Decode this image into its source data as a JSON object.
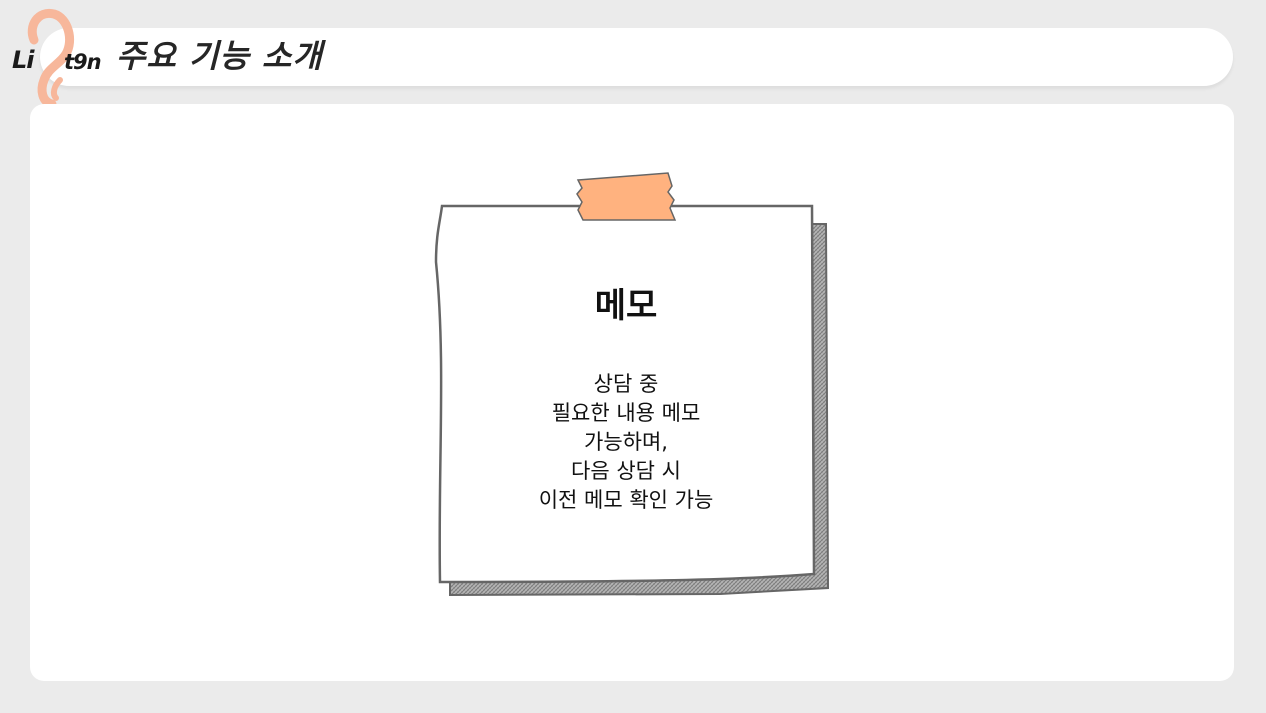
{
  "header": {
    "logo_text_left": "Li",
    "logo_text_right": "t9n",
    "title": "주요 기능 소개"
  },
  "note": {
    "title": "메모",
    "lines": [
      "상담 중",
      "필요한 내용 메모",
      "가능하며,",
      "다음 상담 시",
      "이전 메모 확인 가능"
    ]
  },
  "colors": {
    "background": "#ebebeb",
    "panel": "#ffffff",
    "tape": "#ffb27f",
    "logo_ear": "#f7b79b",
    "note_outline": "#666666"
  },
  "icons": {
    "logo": "ear-logo-icon",
    "tape": "tape-icon"
  }
}
